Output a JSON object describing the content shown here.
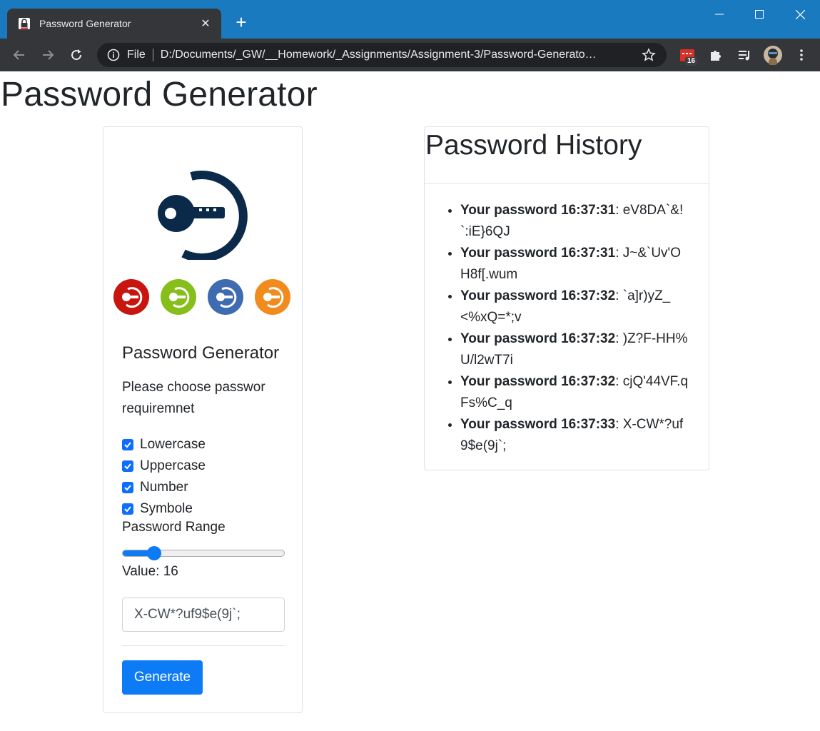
{
  "browser": {
    "tab_title": "Password Generator",
    "url_scheme": "File",
    "url": "D:/Documents/_GW/__Homework/_Assignments/Assignment-3/Password-Generato…",
    "extension_badge": "16"
  },
  "page": {
    "title": "Password Generator"
  },
  "generator": {
    "heading": "Password Generator",
    "instructions": "Please choose passwor requiremnet",
    "options": [
      {
        "label": "Lowercase",
        "checked": true
      },
      {
        "label": "Uppercase",
        "checked": true
      },
      {
        "label": "Number",
        "checked": true
      },
      {
        "label": "Symbole",
        "checked": true
      }
    ],
    "range_label": "Password Range",
    "range_value_fraction": 0.17,
    "value_text": "Value: 16",
    "password_output": "X-CW*?uf9$e(9j`;",
    "generate_label": "Generate",
    "colors": {
      "primary": "#0d7af6",
      "logo": "#0b2a4a",
      "red": "#c8150f",
      "green": "#86be1a",
      "blue": "#3f6bb0",
      "orange": "#f28b1d"
    }
  },
  "history": {
    "title": "Password History",
    "items": [
      {
        "label": "Your password 16:37:31",
        "password": ": eV8DA`&!`:iE}6QJ"
      },
      {
        "label": "Your password 16:37:31",
        "password": ": J~&`Uv'OH8f[.wum"
      },
      {
        "label": "Your password 16:37:32",
        "password": ": `a]r)yZ_<%xQ=*;v"
      },
      {
        "label": "Your password 16:37:32",
        "password": ": )Z?F-HH%U/l2wT7i"
      },
      {
        "label": "Your password 16:37:32",
        "password": ": cjQ'44VF.qFs%C_q"
      },
      {
        "label": "Your password 16:37:33",
        "password": ": X-CW*?uf9$e(9j`;"
      }
    ]
  }
}
